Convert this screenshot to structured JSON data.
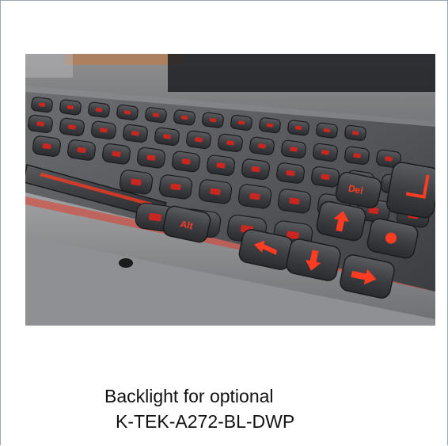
{
  "photo": {
    "subject": "backlit-metal-keyboard",
    "key_legends": [
      "Alt",
      "Del"
    ],
    "backlight_color": "#e0231b"
  },
  "caption": {
    "line1": "Backlight for optional",
    "line2": "K-TEK-A272-BL-DWP"
  }
}
